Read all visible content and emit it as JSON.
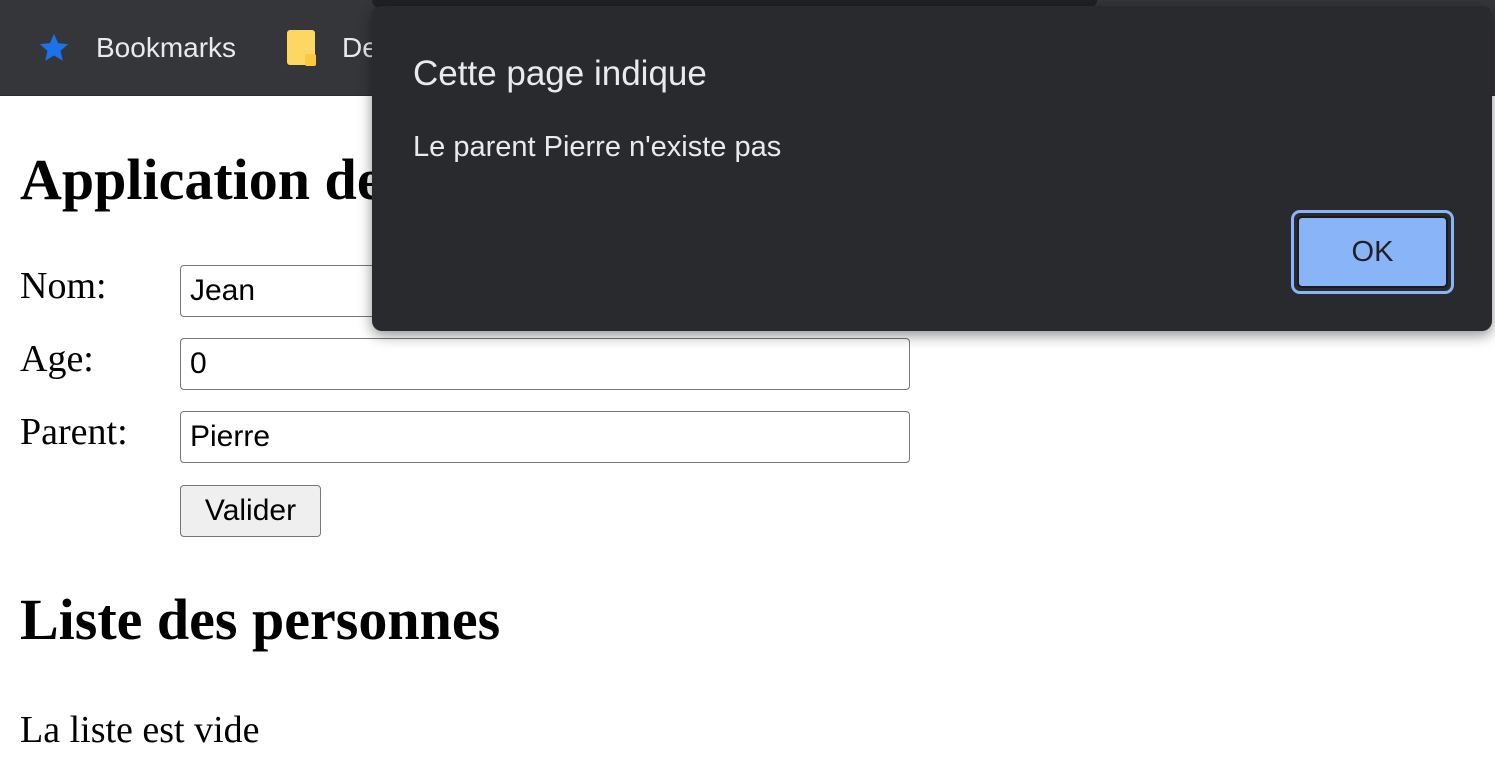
{
  "bookmarks_bar": {
    "bookmarks_label": "Bookmarks",
    "folder_label": "De"
  },
  "page": {
    "app_title": "Application de",
    "form": {
      "nom_label": "Nom:",
      "nom_value": "Jean",
      "age_label": "Age:",
      "age_value": "0",
      "parent_label": "Parent:",
      "parent_value": "Pierre",
      "submit_label": "Valider"
    },
    "list_title": "Liste des personnes",
    "empty_message": "La liste est vide"
  },
  "dialog": {
    "title": "Cette page indique",
    "message": "Le parent Pierre n'existe pas",
    "ok_label": "OK"
  },
  "colors": {
    "toolbar_bg": "#35363a",
    "dialog_bg": "#292a2d",
    "dialog_button": "#8ab4f8",
    "star_icon": "#1a73e8",
    "folder_icon": "#fdd663"
  }
}
